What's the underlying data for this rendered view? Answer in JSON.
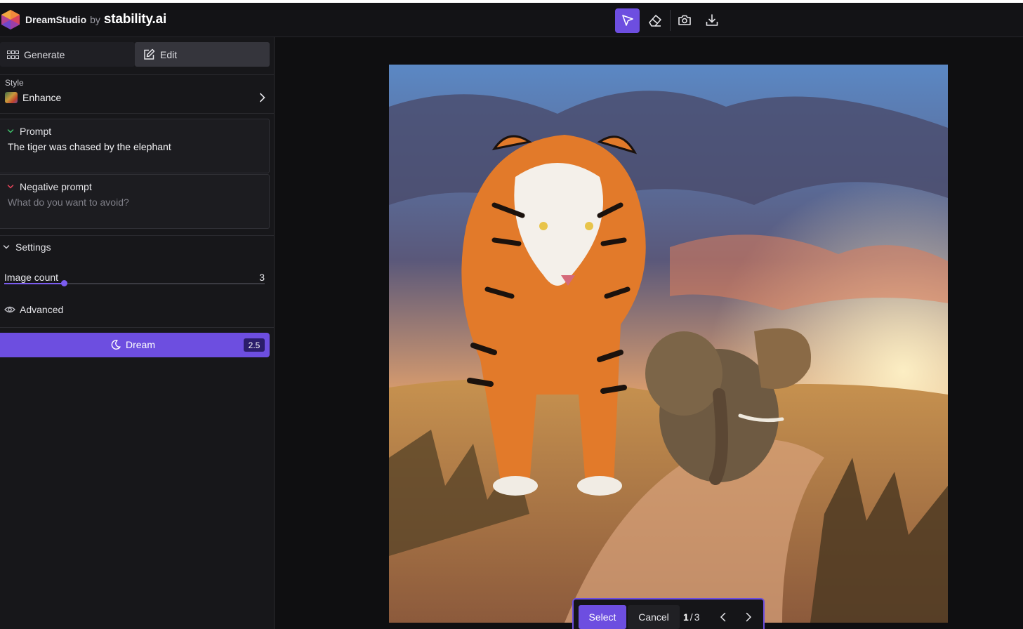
{
  "app": {
    "name": "DreamStudio",
    "by": "by",
    "company": "stability.ai"
  },
  "toolbar": {
    "tools": [
      "select-tool",
      "eraser-tool",
      "camera-tool",
      "download-tool"
    ],
    "active": "select-tool",
    "accent": "#6d4ee0"
  },
  "sidebar": {
    "tabs": [
      {
        "label": "Generate",
        "icon": "grid-icon"
      },
      {
        "label": "Edit",
        "icon": "edit-icon",
        "active": true
      }
    ],
    "style": {
      "label": "Style",
      "value": "Enhance"
    },
    "prompt": {
      "label": "Prompt",
      "value": "The tiger was chased by the elephant"
    },
    "negative_prompt": {
      "label": "Negative prompt",
      "placeholder": "What do you want to avoid?"
    },
    "settings": {
      "label": "Settings",
      "image_count": {
        "label": "Image count",
        "value": "3",
        "level": 0.23
      },
      "advanced_label": "Advanced"
    },
    "dream": {
      "label": "Dream",
      "cost": "2.5"
    }
  },
  "canvas": {
    "image_description_icon": "generated-image",
    "select_bar": {
      "select_label": "Select",
      "cancel_label": "Cancel",
      "current": "1",
      "separator": "/",
      "total": "3"
    }
  }
}
